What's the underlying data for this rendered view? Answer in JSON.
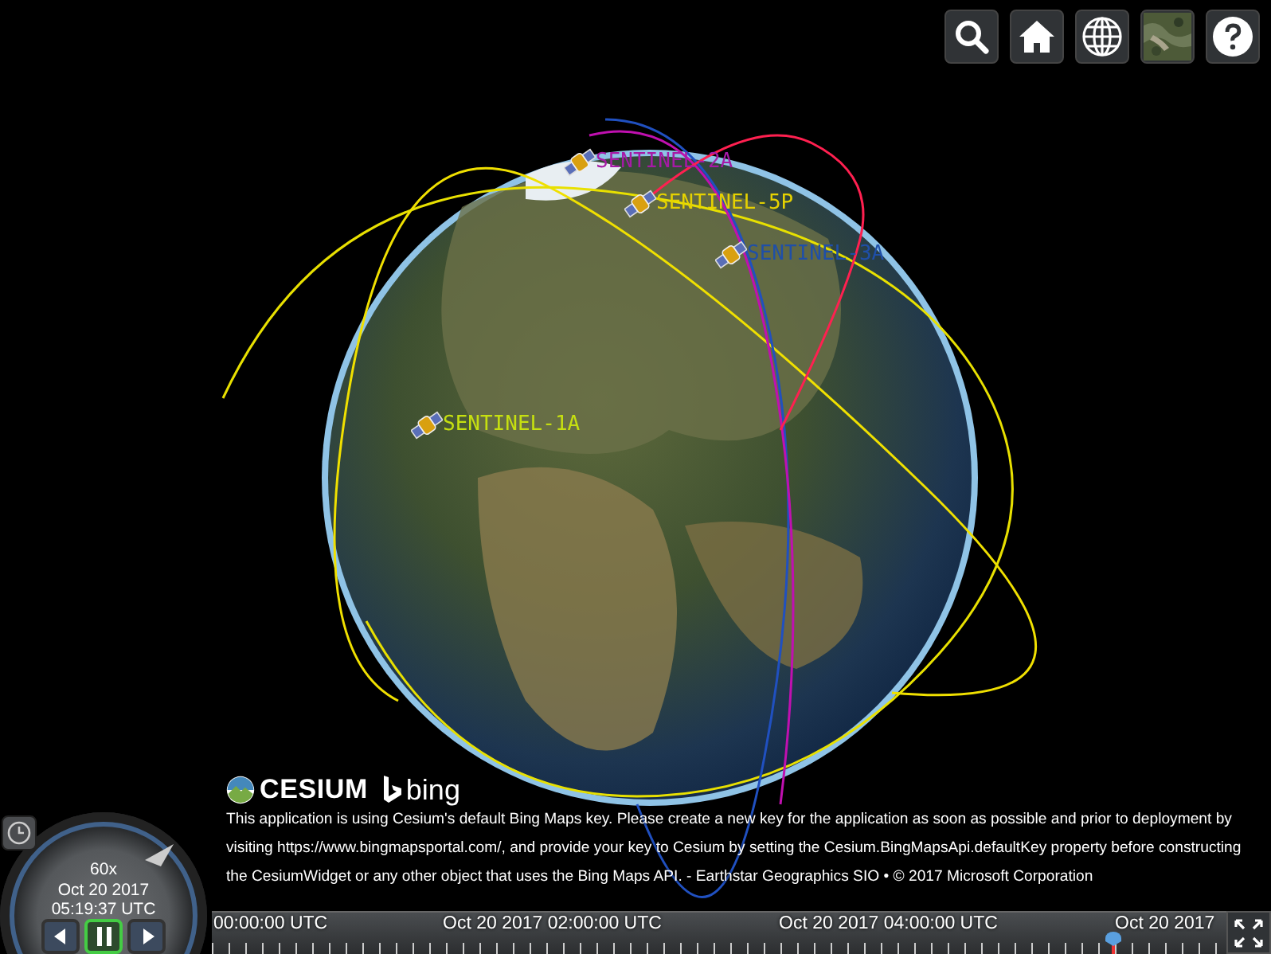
{
  "toolbar": {
    "buttons": [
      {
        "kind": "search"
      },
      {
        "kind": "home"
      },
      {
        "kind": "globe"
      },
      {
        "kind": "imagery"
      },
      {
        "kind": "help"
      }
    ]
  },
  "satellites": [
    {
      "name": "SENTINEL-2A",
      "color": "#a61aa6"
    },
    {
      "name": "SENTINEL-5P",
      "color": "#e6d200"
    },
    {
      "name": "SENTINEL-3A",
      "color": "#1f4fa8"
    },
    {
      "name": "SENTINEL-1A",
      "color": "#c6e010"
    }
  ],
  "credits": {
    "logos": [
      "CESIUM",
      "bing"
    ],
    "text": "This application is using Cesium's default Bing Maps key. Please create a new key for the application as soon as possible and prior to deployment by visiting https://www.bingmapsportal.com/, and provide your key to Cesium by setting the Cesium.BingMapsApi.defaultKey property before constructing the CesiumWidget or any other object that uses the Bing Maps API. - Earthstar Geographics SIO • © 2017 Microsoft Corporation"
  },
  "animation": {
    "speed": "60x",
    "date": "Oct 20 2017",
    "time": "05:19:37 UTC",
    "buttons": [
      {
        "kind": "reverse",
        "selected": false
      },
      {
        "kind": "pause",
        "selected": true
      },
      {
        "kind": "play",
        "selected": false
      }
    ]
  },
  "timeline": {
    "labels": [
      "00:00:00 UTC",
      "Oct 20 2017 02:00:00 UTC",
      "Oct 20 2017 04:00:00 UTC",
      "Oct 20 2017"
    ],
    "scrubber": {
      "level": 0.888
    }
  }
}
